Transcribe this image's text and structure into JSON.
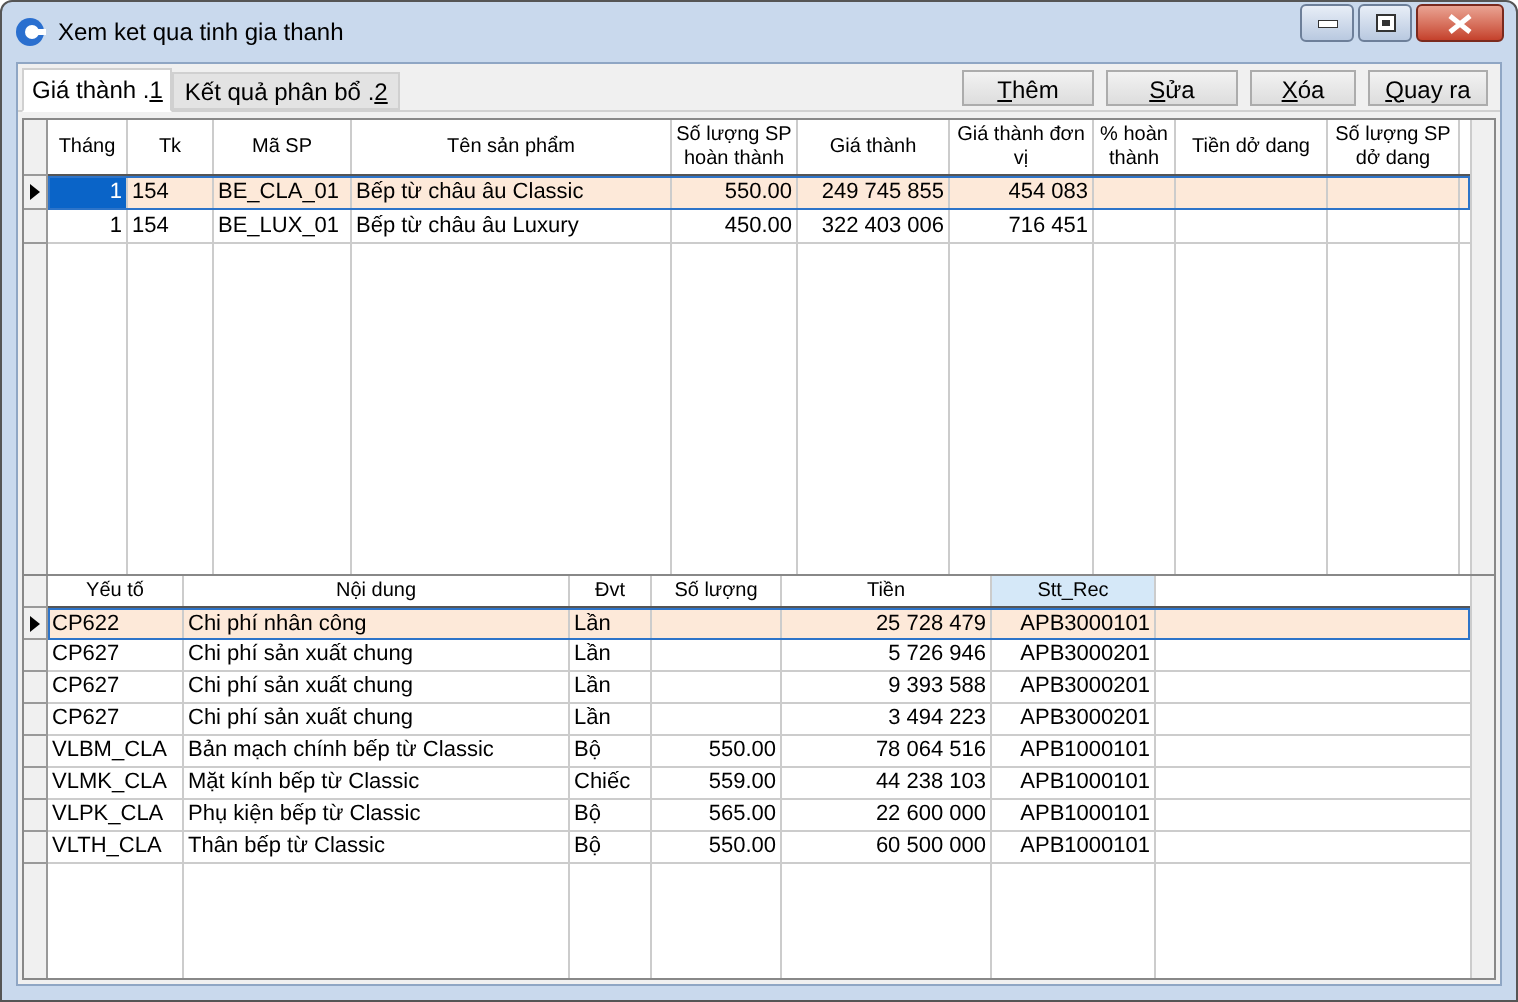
{
  "window": {
    "title": "Xem ket qua tinh gia thanh"
  },
  "tabs": [
    {
      "before": "Giá thành .",
      "accel": "1",
      "selected": true
    },
    {
      "before": "Kết quả phân bổ .",
      "accel": "2",
      "selected": false
    }
  ],
  "buttons": [
    {
      "accel": "T",
      "after": "hêm"
    },
    {
      "accel": "S",
      "after": "ửa"
    },
    {
      "accel": "X",
      "after": "óa"
    },
    {
      "accel": "Q",
      "after": "uay ra"
    }
  ],
  "top_table": {
    "focused": true,
    "columns": [
      {
        "label": "Tháng",
        "highlighted": false
      },
      {
        "label": "Tk",
        "highlighted": false
      },
      {
        "label": "Mã SP",
        "highlighted": false
      },
      {
        "label": "Tên sản phẩm",
        "highlighted": false
      },
      {
        "label": "Số lượng SP hoàn thành",
        "highlighted": false
      },
      {
        "label": "Giá thành",
        "highlighted": false
      },
      {
        "label": "Giá thành đơn vị",
        "highlighted": false
      },
      {
        "label": "% hoàn thành",
        "highlighted": false
      },
      {
        "label": "Tiền dở dang",
        "highlighted": false
      },
      {
        "label": "Số lượng SP dở dang",
        "highlighted": false
      }
    ],
    "rows": [
      {
        "selected": true,
        "cells": [
          "1",
          "154",
          "BE_CLA_01",
          "Bếp từ châu âu Classic",
          "550.00",
          "249 745 855",
          "454 083",
          "",
          "",
          ""
        ]
      },
      {
        "selected": false,
        "cells": [
          "1",
          "154",
          "BE_LUX_01",
          "Bếp từ châu âu Luxury",
          "450.00",
          "322 403 006",
          "716 451",
          "",
          "",
          ""
        ]
      }
    ]
  },
  "bottom_table": {
    "focused": false,
    "columns": [
      {
        "label": "Yếu tố",
        "highlighted": false
      },
      {
        "label": "Nội dung",
        "highlighted": false
      },
      {
        "label": "Đvt",
        "highlighted": false
      },
      {
        "label": "Số lượng",
        "highlighted": false
      },
      {
        "label": "Tiền",
        "highlighted": false
      },
      {
        "label": "Stt_Rec",
        "highlighted": true
      }
    ],
    "rows": [
      {
        "selected": true,
        "cells": [
          "CP622",
          "Chi phí nhân công",
          "Lần",
          "",
          "25 728 479",
          "APB3000101"
        ]
      },
      {
        "selected": false,
        "cells": [
          "CP627",
          "Chi phí sản xuất chung",
          "Lần",
          "",
          "5 726 946",
          "APB3000201"
        ]
      },
      {
        "selected": false,
        "cells": [
          "CP627",
          "Chi phí sản xuất chung",
          "Lần",
          "",
          "9 393 588",
          "APB3000201"
        ]
      },
      {
        "selected": false,
        "cells": [
          "CP627",
          "Chi phí sản xuất chung",
          "Lần",
          "",
          "3 494 223",
          "APB3000201"
        ]
      },
      {
        "selected": false,
        "cells": [
          "VLBM_CLA",
          "Bản mạch chính bếp từ Classic",
          "Bộ",
          "550.00",
          "78 064 516",
          "APB1000101"
        ]
      },
      {
        "selected": false,
        "cells": [
          "VLMK_CLA",
          "Mặt kính bếp từ Classic",
          "Chiếc",
          "559.00",
          "44 238 103",
          "APB1000101"
        ]
      },
      {
        "selected": false,
        "cells": [
          "VLPK_CLA",
          "Phụ kiện bếp từ Classic",
          "Bộ",
          "565.00",
          "22 600 000",
          "APB1000101"
        ]
      },
      {
        "selected": false,
        "cells": [
          "VLTH_CLA",
          "Thân bếp từ Classic",
          "Bộ",
          "550.00",
          "60 500 000",
          "APB1000101"
        ]
      }
    ]
  }
}
